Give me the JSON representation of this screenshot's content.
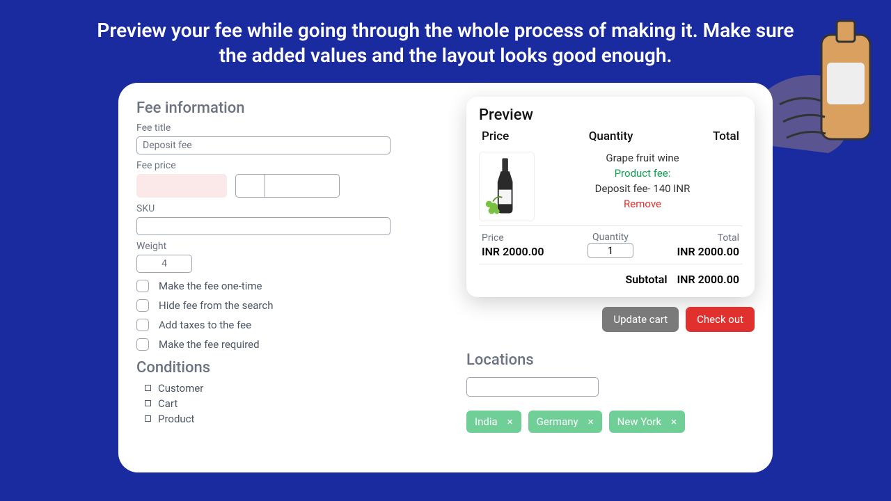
{
  "headline": "Preview your fee while going through the whole process of making it. Make sure the added values and the layout looks good enough.",
  "form": {
    "section_title": "Fee information",
    "fee_title_label": "Fee title",
    "fee_title_value": "Deposit fee",
    "fee_price_label": "Fee price",
    "sku_label": "SKU",
    "sku_value": "",
    "weight_label": "Weight",
    "weight_value": "4",
    "checks": [
      "Make the fee one-time",
      "Hide fee from the search",
      "Add taxes to the fee",
      "Make the fee required"
    ],
    "conditions_title": "Conditions",
    "conditions": [
      "Customer",
      "Cart",
      "Product"
    ]
  },
  "preview": {
    "title": "Preview",
    "head_price": "Price",
    "head_qty": "Quantity",
    "head_total": "Total",
    "product_name": "Grape fruit wine",
    "product_fee_label": "Product fee:",
    "fee_line": "Deposit fee- 140 INR",
    "remove": "Remove",
    "price_label": "Price",
    "price_value": "INR 2000.00",
    "qty_label": "Quantity",
    "qty_value": "1",
    "total_label": "Total",
    "total_value": "INR 2000.00",
    "subtotal_label": "Subtotal",
    "subtotal_value": "INR 2000.00"
  },
  "buttons": {
    "update": "Update cart",
    "checkout": "Check out"
  },
  "locations": {
    "title": "Locations",
    "tags": [
      "India",
      "Germany",
      "New York"
    ]
  }
}
